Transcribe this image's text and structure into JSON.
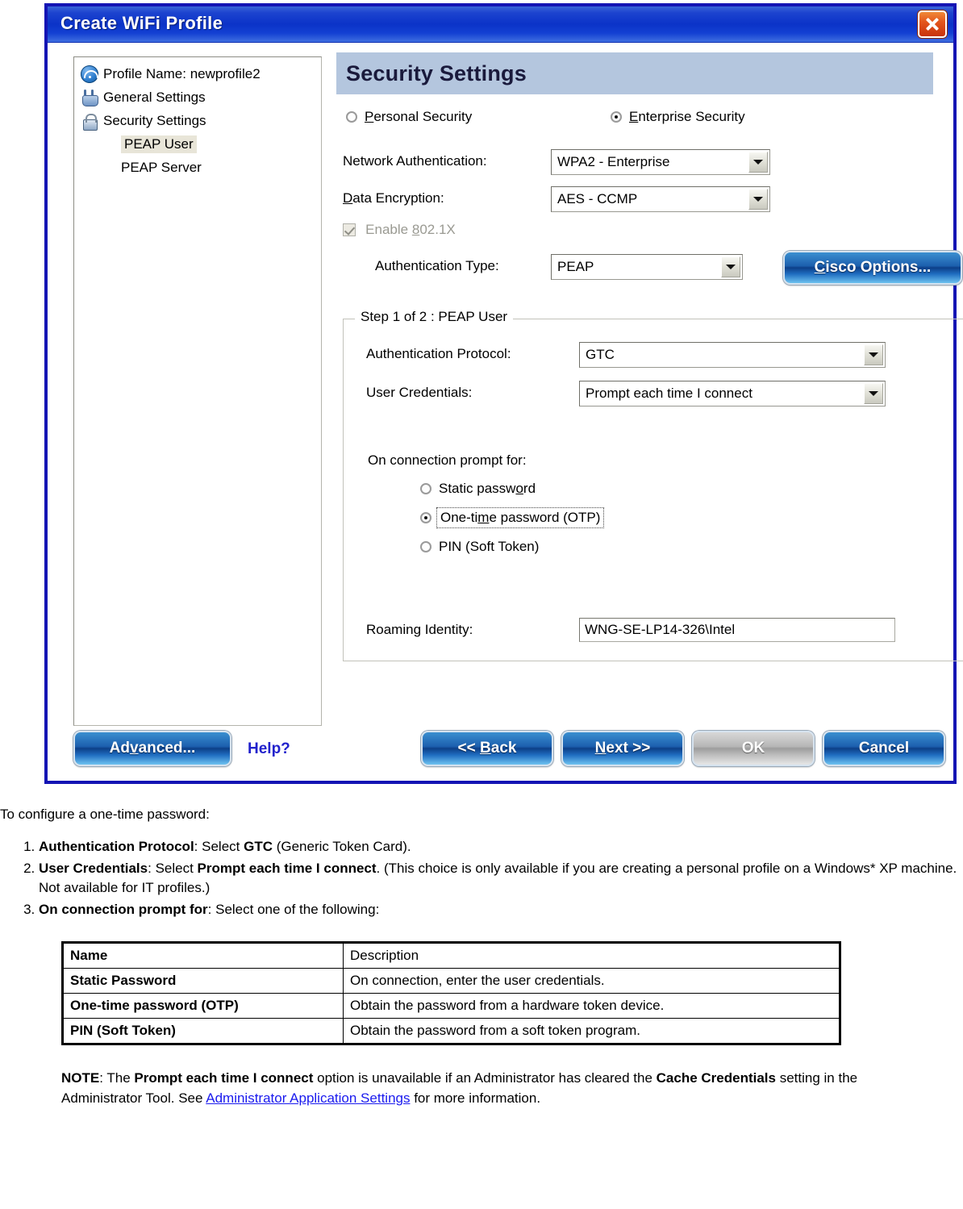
{
  "dialog": {
    "title": "Create WiFi Profile",
    "close_label": "close-window",
    "tree": {
      "items": [
        {
          "label": "Profile Name: newprofile2",
          "icon": "wifi-icon",
          "indent": false,
          "selected": false
        },
        {
          "label": "General Settings",
          "icon": "device-icon",
          "indent": false,
          "selected": false
        },
        {
          "label": "Security Settings",
          "icon": "lock-icon",
          "indent": false,
          "selected": false
        },
        {
          "label": "PEAP User",
          "icon": "none",
          "indent": true,
          "selected": true
        },
        {
          "label": "PEAP Server",
          "icon": "none",
          "indent": true,
          "selected": false
        }
      ]
    },
    "section_title": "Security Settings",
    "security_mode": {
      "personal_label": "Personal Security",
      "personal_selected": false,
      "enterprise_label": "Enterprise Security",
      "enterprise_selected": true
    },
    "fields": {
      "network_auth_label": "Network Authentication:",
      "network_auth_value": "WPA2 - Enterprise",
      "data_encryption_label": "Data Encryption:",
      "data_encryption_value": "AES - CCMP",
      "enable_8021x_label": "Enable 802.1X",
      "enable_8021x_checked": true,
      "enable_8021x_disabled": true,
      "auth_type_label": "Authentication Type:",
      "auth_type_value": "PEAP",
      "cisco_options_label": "Cisco Options..."
    },
    "step_group": {
      "title": "Step 1 of 2 : PEAP User",
      "auth_protocol_label": "Authentication Protocol:",
      "auth_protocol_value": "GTC",
      "user_credentials_label": "User Credentials:",
      "user_credentials_value": "Prompt each time I connect",
      "prompt_title": "On connection prompt for:",
      "prompt_options": [
        {
          "label": "Static password",
          "selected": false,
          "focused": false
        },
        {
          "label": "One-time password (OTP)",
          "selected": true,
          "focused": true
        },
        {
          "label": "PIN (Soft Token)",
          "selected": false,
          "focused": false
        }
      ],
      "roaming_identity_label": "Roaming Identity:",
      "roaming_identity_value": "WNG-SE-LP14-326\\Intel"
    },
    "buttons": {
      "advanced": "Advanced...",
      "help": "Help?",
      "back": "<< Back",
      "next": "Next >>",
      "ok": "OK",
      "cancel": "Cancel"
    }
  },
  "doc": {
    "intro": "To configure a one-time password:",
    "steps": [
      {
        "term": "Authentication Protocol",
        "rest_a": ": Select ",
        "bold_b": "GTC",
        "rest_b": " (Generic Token Card)."
      },
      {
        "term": "User Credentials",
        "rest_a": ": Select ",
        "bold_b": "Prompt each time I connect",
        "rest_b": ". (This choice is only available if you are creating a personal profile on a Windows* XP machine. Not available for IT profiles.)"
      },
      {
        "term": "On connection prompt for",
        "rest_a": ": Select one of the following:",
        "bold_b": "",
        "rest_b": ""
      }
    ],
    "table": {
      "headers": [
        "Name",
        "Description"
      ],
      "rows": [
        [
          "Static Password",
          "On connection, enter the user credentials."
        ],
        [
          "One-time password (OTP)",
          "Obtain the password from a hardware token device."
        ],
        [
          "PIN (Soft Token)",
          "Obtain the password from a soft token program."
        ]
      ]
    },
    "note": {
      "label": "NOTE",
      "part1": ": The ",
      "bold1": "Prompt each time I connect",
      "part2": " option is unavailable if an Administrator has cleared the ",
      "bold2": "Cache Credentials",
      "part3": " setting in the Administrator Tool. See ",
      "link": "Administrator Application Settings",
      "part4": " for more information."
    }
  }
}
